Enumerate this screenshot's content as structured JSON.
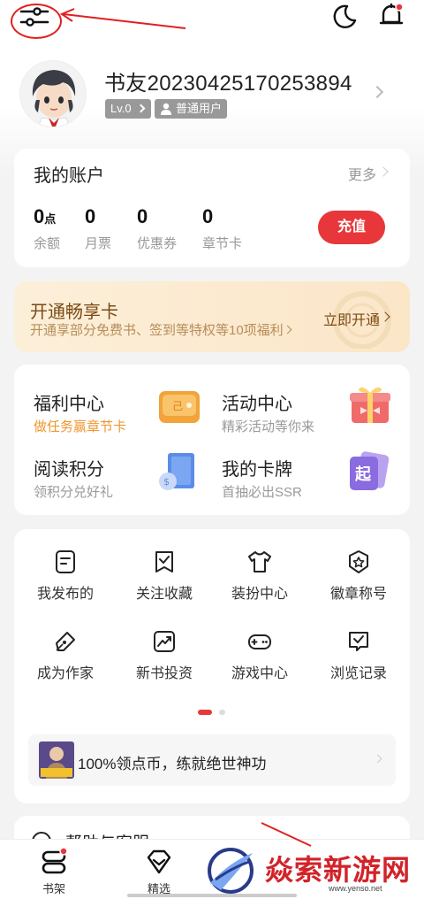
{
  "top_bar": {
    "settings_icon": "filter-sliders-icon",
    "night_icon": "moon-icon",
    "notification_icon": "bell-icon"
  },
  "profile": {
    "username": "书友20230425170253894",
    "level_badge": "Lv.0",
    "user_type_badge": "普通用户"
  },
  "account": {
    "title": "我的账户",
    "more_label": "更多",
    "stats": [
      {
        "value": "0",
        "unit": "点",
        "label": "余额"
      },
      {
        "value": "0",
        "unit": "",
        "label": "月票"
      },
      {
        "value": "0",
        "unit": "",
        "label": "优惠券"
      },
      {
        "value": "0",
        "unit": "",
        "label": "章节卡"
      }
    ],
    "recharge_label": "充值"
  },
  "vip": {
    "title": "开通畅享卡",
    "subtitle": "开通享部分免费书、签到等特权等10项福利",
    "action": "立即开通"
  },
  "features": [
    {
      "title": "福利中心",
      "subtitle": "做任务赢章节卡",
      "highlight": true,
      "icon": "coin-wallet-icon"
    },
    {
      "title": "活动中心",
      "subtitle": "精彩活动等你来",
      "highlight": false,
      "icon": "gift-box-icon"
    },
    {
      "title": "阅读积分",
      "subtitle": "领积分兑好礼",
      "highlight": false,
      "icon": "reading-points-icon"
    },
    {
      "title": "我的卡牌",
      "subtitle": "首抽必出SSR",
      "highlight": false,
      "icon": "card-deck-icon"
    }
  ],
  "grid": [
    {
      "label": "我发布的",
      "icon": "document-icon"
    },
    {
      "label": "关注收藏",
      "icon": "bookmark-check-icon"
    },
    {
      "label": "装扮中心",
      "icon": "tshirt-icon"
    },
    {
      "label": "徽章称号",
      "icon": "badge-star-icon"
    },
    {
      "label": "成为作家",
      "icon": "pen-icon"
    },
    {
      "label": "新书投资",
      "icon": "trend-chart-icon"
    },
    {
      "label": "游戏中心",
      "icon": "gamepad-icon"
    },
    {
      "label": "浏览记录",
      "icon": "history-heart-icon"
    }
  ],
  "promo": {
    "text": "100%领点币，练就绝世神功"
  },
  "help": {
    "text": "帮助与客服"
  },
  "bottom_nav": [
    {
      "label": "书架",
      "icon": "bookshelf-icon"
    },
    {
      "label": "精选",
      "icon": "diamond-icon"
    }
  ],
  "watermark": {
    "text": "焱索新游网",
    "url": "www.yenso.net"
  },
  "colors": {
    "accent": "#e8373a",
    "vip_text": "#7a4a14",
    "highlight": "#f0962e",
    "annotation": "#e02020"
  }
}
